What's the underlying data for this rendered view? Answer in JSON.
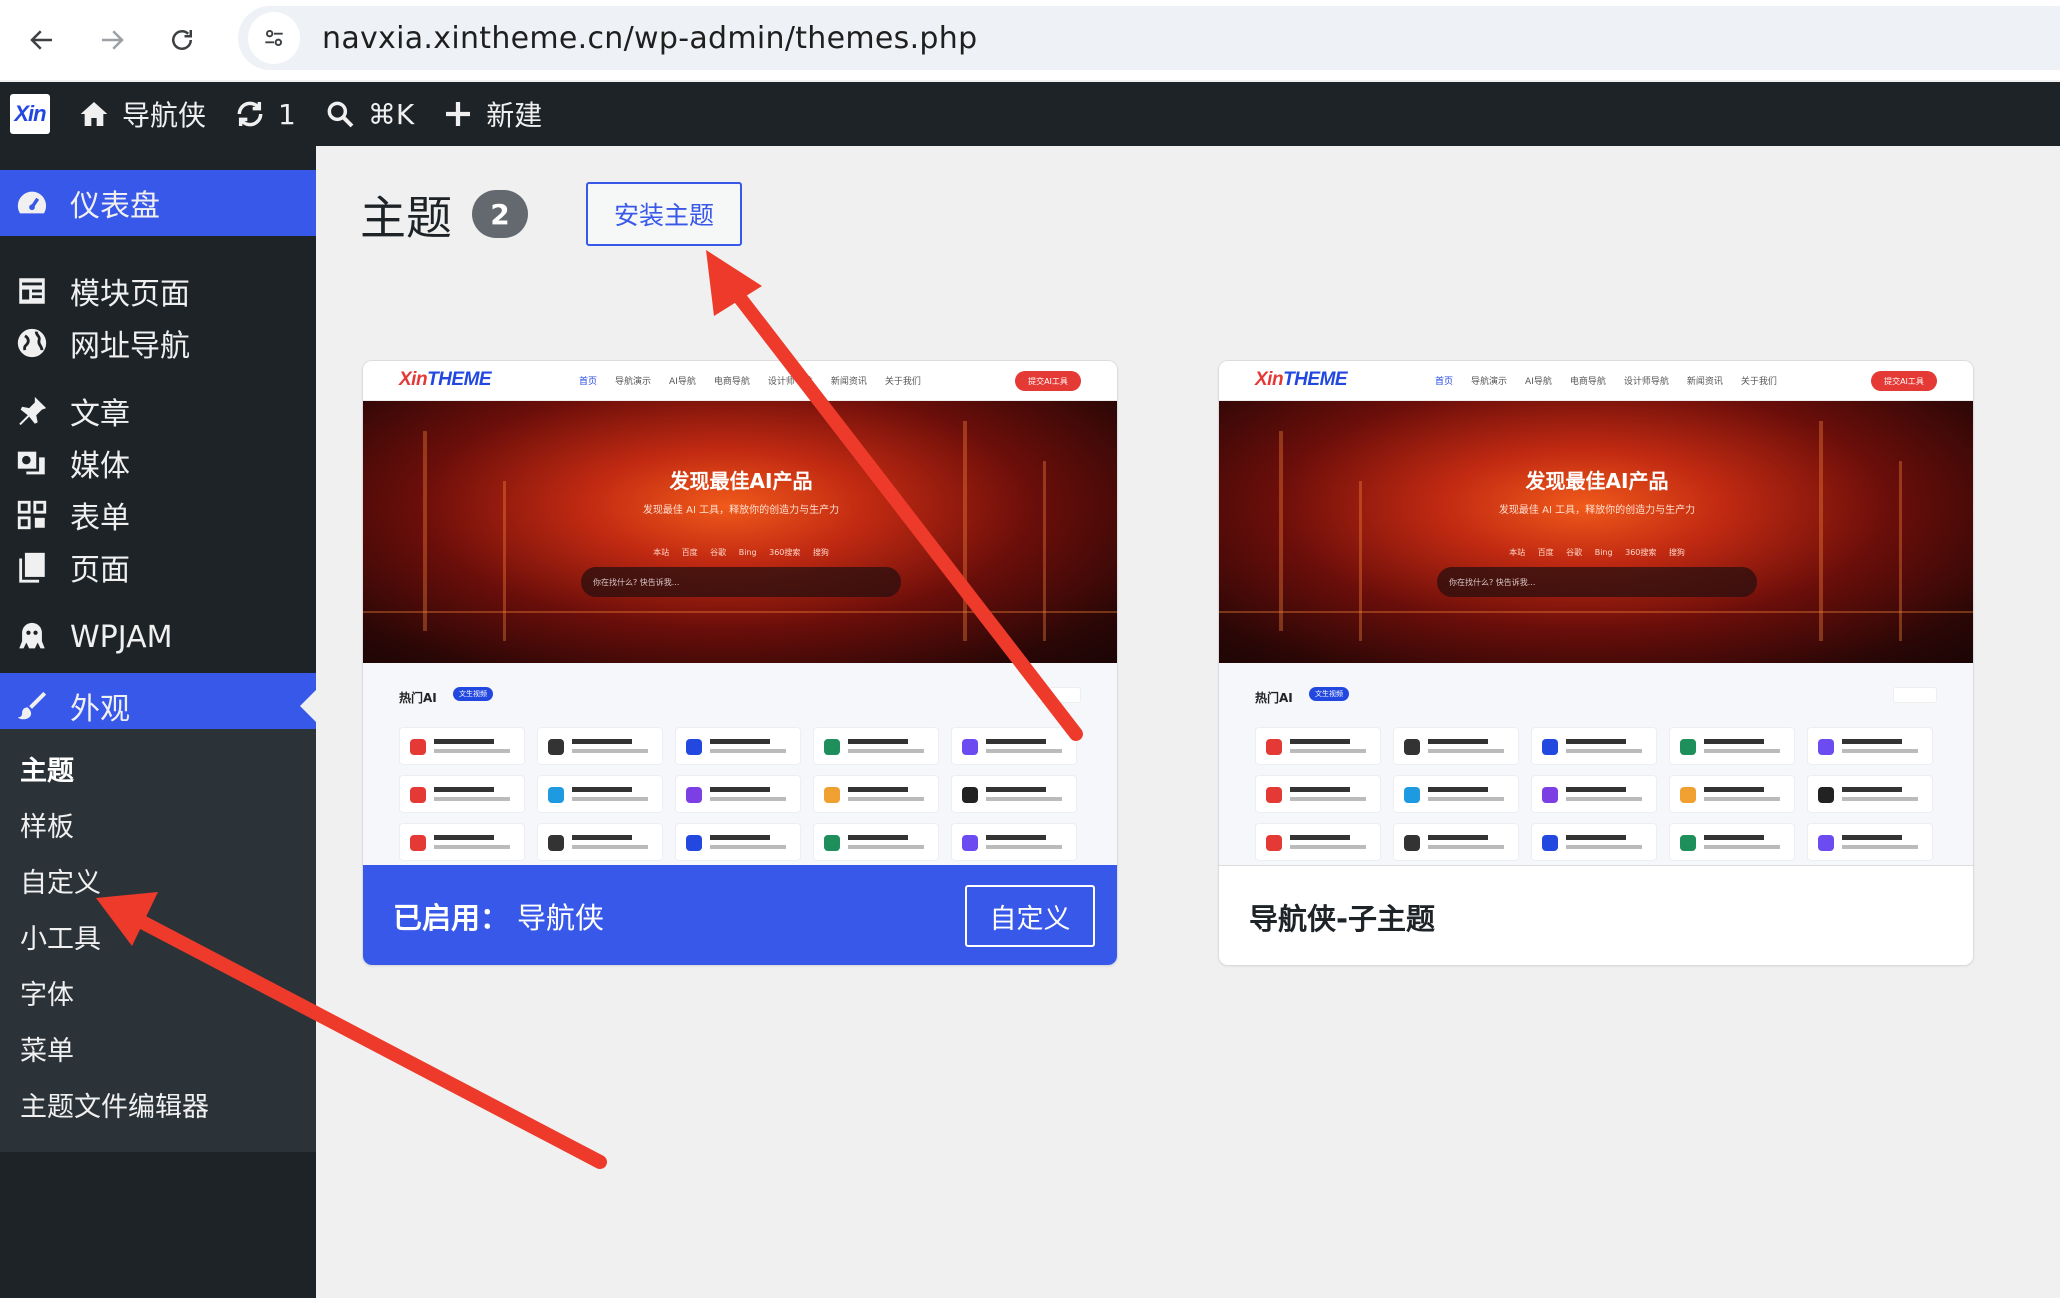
{
  "browser": {
    "url": "navxia.xintheme.cn/wp-admin/themes.php"
  },
  "admin_bar": {
    "logo": "Xin",
    "site_name": "导航侠",
    "updates_count": "1",
    "search_shortcut": "⌘K",
    "new_label": "新建"
  },
  "sidebar": {
    "dashboard": "仪表盘",
    "modules": "模块页面",
    "url_nav": "网址导航",
    "posts": "文章",
    "media": "媒体",
    "forms": "表单",
    "pages": "页面",
    "wpjam": "WPJAM",
    "appearance": "外观",
    "submenu": {
      "themes": "主题",
      "patterns": "样板",
      "customize": "自定义",
      "widgets": "小工具",
      "fonts": "字体",
      "menus": "菜单",
      "theme_editor": "主题文件编辑器"
    }
  },
  "main": {
    "title": "主题",
    "theme_count": "2",
    "install_button": "安装主题"
  },
  "themes": [
    {
      "active_label": "已启用：",
      "name": "导航侠",
      "customize_button": "自定义",
      "screenshot": {
        "logo_a": "Xin",
        "logo_b": "THEME",
        "nav": [
          "首页",
          "导航演示",
          "AI导航",
          "电商导航",
          "设计师导航",
          "新闻资讯",
          "关于我们"
        ],
        "cta": "提交AI工具",
        "hero_title": "发现最佳AI产品",
        "hero_subtitle": "发现最佳 AI 工具，释放你的创造力与生产力",
        "hero_tabs": "本站 百度 谷歌 Bing 360搜索 搜狗",
        "search_placeholder": "你在找什么? 快告诉我...",
        "section_title": "热门AI",
        "section_pill": "文生视频"
      }
    },
    {
      "name": "导航侠-子主题",
      "screenshot": {
        "logo_a": "Xin",
        "logo_b": "THEME",
        "nav": [
          "首页",
          "导航演示",
          "AI导航",
          "电商导航",
          "设计师导航",
          "新闻资讯",
          "关于我们"
        ],
        "cta": "提交AI工具",
        "hero_title": "发现最佳AI产品",
        "hero_subtitle": "发现最佳 AI 工具，释放你的创造力与生产力",
        "hero_tabs": "本站 百度 谷歌 Bing 360搜索 搜狗",
        "search_placeholder": "你在找什么? 快告诉我...",
        "section_title": "热门AI",
        "section_pill": "文生视频"
      }
    }
  ],
  "colors": {
    "wp_blue": "#3858e9",
    "admin_dark": "#1d2327",
    "annotation_red": "#ee3a2a"
  }
}
